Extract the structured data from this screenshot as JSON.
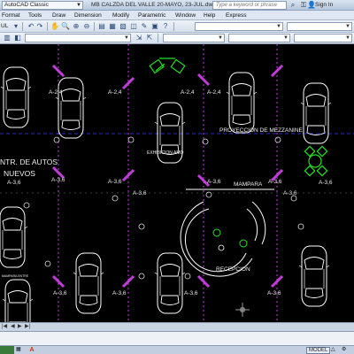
{
  "titlebar": {
    "workspace": "AutoCAD Classic",
    "document_title": "MB CALZDA DEL VALLE 20-MAYO, 23-JUL.dwg",
    "search_placeholder": "Type a keyword or phrase",
    "signin": "Sign In"
  },
  "menubar": {
    "items": [
      "Format",
      "Tools",
      "Draw",
      "Dimension",
      "Modify",
      "Parametric",
      "Window",
      "Help",
      "Express"
    ]
  },
  "toolbar": {
    "layer_fragment": "UL"
  },
  "drawing": {
    "texts": {
      "proyeccion": "PROYECCION DE MEZZANINE",
      "exhibicion": "EXHIBICION AMO",
      "mampara": "MAMPARA",
      "recepcion": "RECEPCION",
      "autos": "NTR. DE AUTOS",
      "nuevos": "NUEVOS",
      "small_label": "MAMPARA ENTRE"
    },
    "column_labels": [
      "A-2,4",
      "A-2,4",
      "A-2,4",
      "A-2,4",
      "A-3,6",
      "A-3,6",
      "A-3,6",
      "A-3,6",
      "A-3,6",
      "A-3,6",
      "A-3,6",
      "A-3,6",
      "A-3,6",
      "A-3,6",
      "A-3,6",
      "A-3,6"
    ],
    "colors": {
      "background": "#000000",
      "column": "#c33cdb",
      "gridline": "#3d3dff",
      "car": "#ffffff",
      "furniture": "#22e022",
      "label": "#e8e8e8"
    }
  },
  "statusbar": {
    "model": "MODEL"
  }
}
